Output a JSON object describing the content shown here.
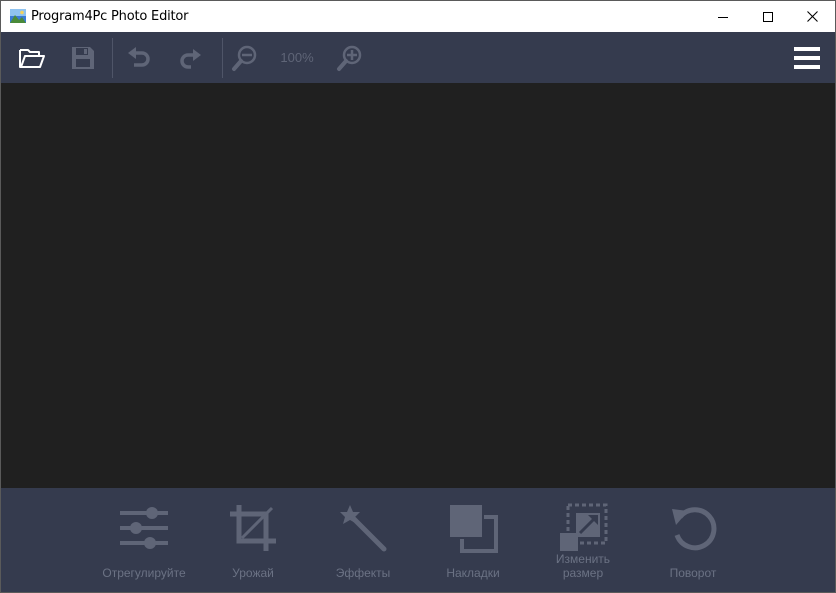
{
  "window": {
    "title": "Program4Pc Photo Editor",
    "controls": [
      "minimize",
      "maximize",
      "close"
    ]
  },
  "toolbar": {
    "items": [
      {
        "name": "open-folder-icon",
        "enabled": true
      },
      {
        "name": "save-icon",
        "enabled": false
      },
      {
        "name": "undo-icon",
        "enabled": false
      },
      {
        "name": "redo-icon",
        "enabled": false
      },
      {
        "name": "zoom-out-icon",
        "enabled": false
      },
      {
        "name": "zoom-in-icon",
        "enabled": false
      },
      {
        "name": "menu-icon",
        "enabled": true
      }
    ],
    "zoom_label": "100%"
  },
  "tools": [
    {
      "label": "Отрегулируйте",
      "icon": "sliders-icon"
    },
    {
      "label": "Урожай",
      "icon": "crop-icon"
    },
    {
      "label": "Эффекты",
      "icon": "magic-wand-icon"
    },
    {
      "label": "Накладки",
      "icon": "overlay-icon"
    },
    {
      "label": "Изменить размер",
      "icon": "resize-icon"
    },
    {
      "label": "Поворот",
      "icon": "rotate-icon"
    }
  ],
  "colors": {
    "toolbar_bg": "#353b4e",
    "canvas_bg": "#202020",
    "icon_enabled": "#ffffff",
    "icon_disabled": "#5f6577",
    "label_color": "#6b7284"
  }
}
